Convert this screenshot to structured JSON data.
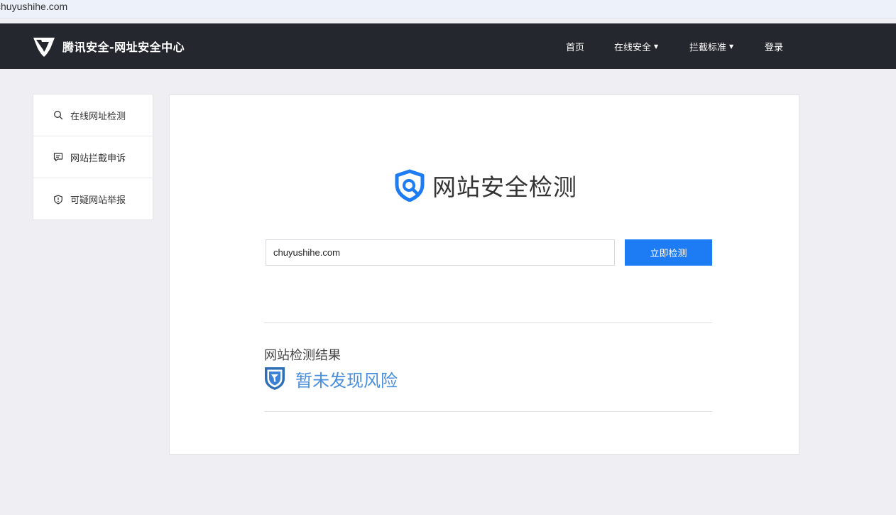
{
  "browser": {
    "url": "chuyushihe.com"
  },
  "navbar": {
    "brand": "腾讯安全-网址安全中心",
    "items": [
      {
        "label": "首页",
        "has_dropdown": false
      },
      {
        "label": "在线安全",
        "has_dropdown": true
      },
      {
        "label": "拦截标准",
        "has_dropdown": true
      },
      {
        "label": "登录",
        "has_dropdown": false
      }
    ],
    "caret": "▼"
  },
  "sidebar": {
    "items": [
      {
        "label": "在线网址检测",
        "icon": "search-icon"
      },
      {
        "label": "网站拦截申诉",
        "icon": "comment-icon"
      },
      {
        "label": "可疑网站举报",
        "icon": "shield-alert-icon"
      }
    ]
  },
  "main": {
    "title": "网站安全检测",
    "search": {
      "value": "chuyushihe.com"
    },
    "check_button": "立即检测",
    "result_label": "网站检测结果",
    "result_status": "暂未发现风险"
  },
  "colors": {
    "navbar_bg": "#24272e",
    "accent": "#1d7cf4",
    "result_blue": "#4a8fde",
    "page_bg": "#eeeef3"
  }
}
